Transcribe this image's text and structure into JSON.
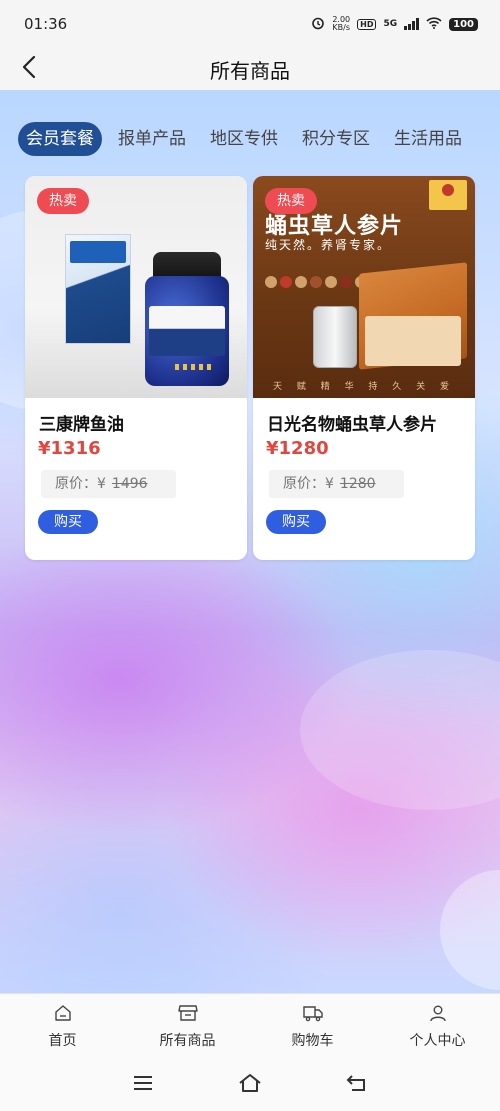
{
  "status_bar": {
    "time": "01:36",
    "net_speed": "2.00",
    "net_unit": "KB/s",
    "hd": "HD",
    "network": "5G",
    "battery": "100"
  },
  "nav": {
    "title": "所有商品",
    "back_icon": "chevron-left-icon"
  },
  "tabs": [
    {
      "label": "会员套餐",
      "active": true
    },
    {
      "label": "报单产品",
      "active": false
    },
    {
      "label": "地区专供",
      "active": false
    },
    {
      "label": "积分专区",
      "active": false
    },
    {
      "label": "生活用品",
      "active": false
    }
  ],
  "products": [
    {
      "badge": "热卖",
      "name": "三康牌鱼油",
      "price": "¥1316",
      "orig_label": "原价：",
      "orig_currency": "¥",
      "orig_price": "1496",
      "buy_label": "购买"
    },
    {
      "badge": "热卖",
      "name": "日光名物蛹虫草人参片",
      "price": "¥1280",
      "orig_label": "原价：",
      "orig_currency": "¥",
      "orig_price": "1280",
      "buy_label": "购买",
      "image_text": {
        "title": "蛹虫草人参片",
        "subtitle": "纯天然。养肾专家。",
        "footer": "天 赋 精 华   持 久 关 爱"
      }
    }
  ],
  "bottom_tabs": [
    {
      "label": "首页",
      "icon": "home-icon"
    },
    {
      "label": "所有商品",
      "icon": "store-icon"
    },
    {
      "label": "购物车",
      "icon": "truck-icon"
    },
    {
      "label": "个人中心",
      "icon": "user-icon"
    }
  ],
  "colors": {
    "accent": "#214f96",
    "price": "#e2473f",
    "badge": "#ef4b53",
    "buy_button": "#2f5fe0"
  }
}
